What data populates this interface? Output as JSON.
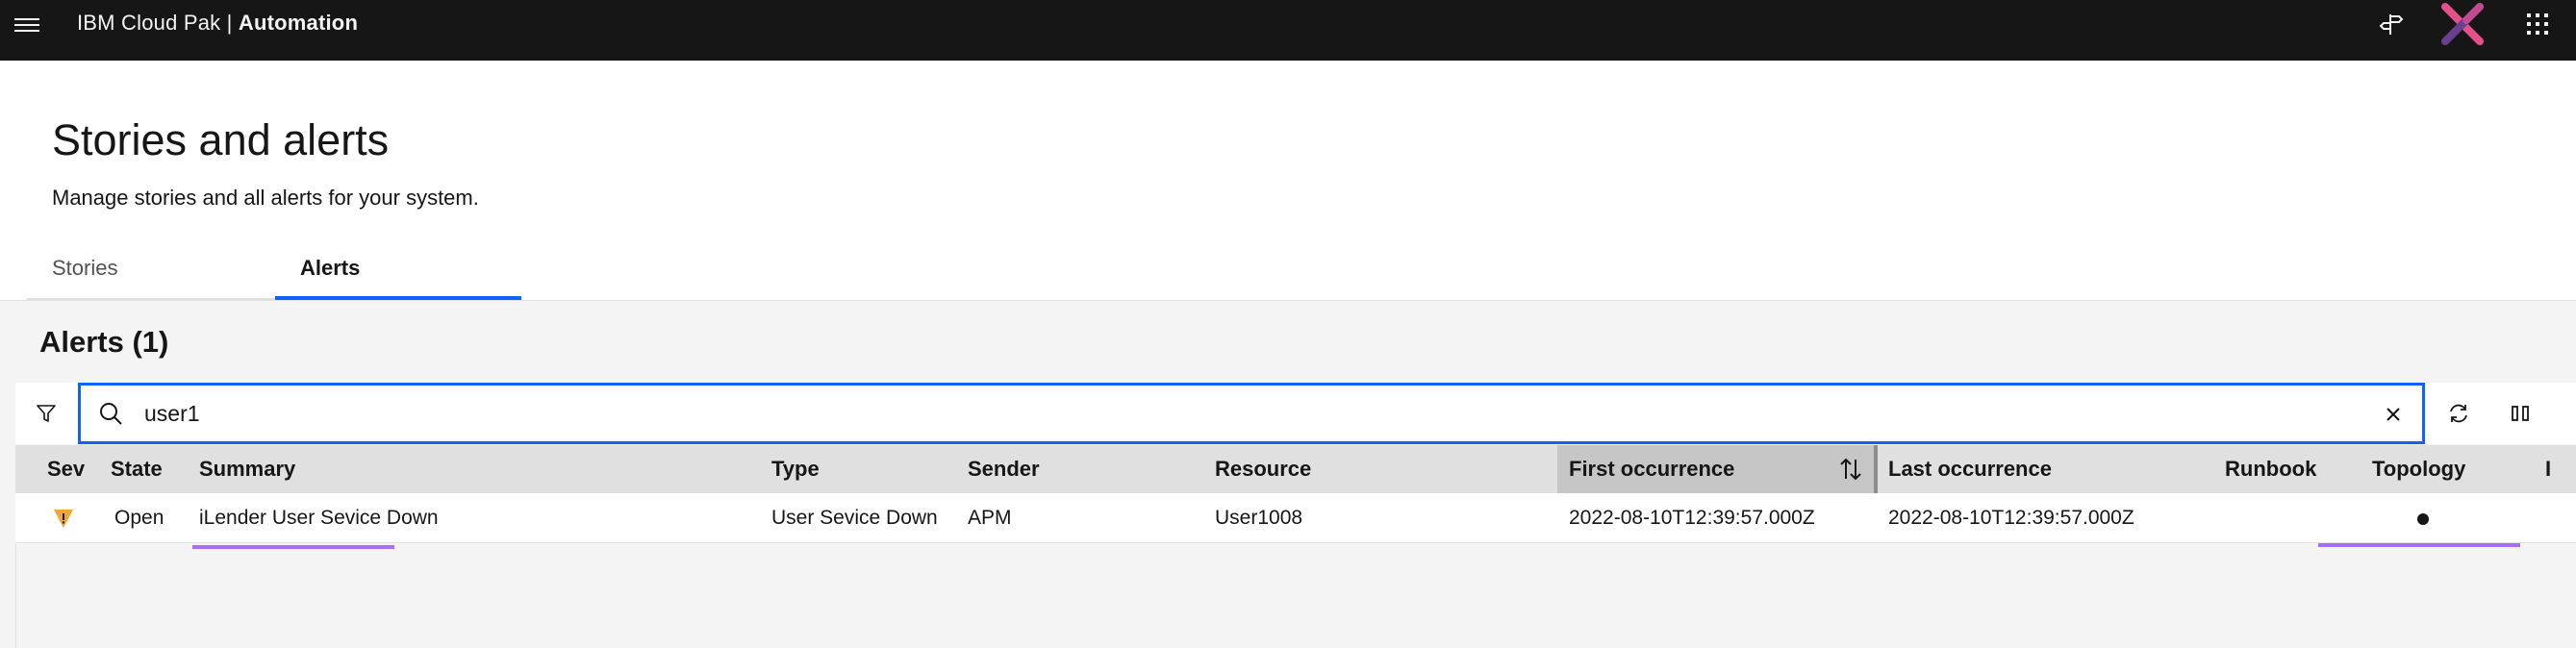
{
  "header": {
    "brand_prefix": "IBM Cloud Pak |",
    "brand_product": "Automation",
    "icons": [
      "menu-icon",
      "signpost-icon",
      "avatar-icon",
      "app-switcher-icon"
    ]
  },
  "page": {
    "title": "Stories and alerts",
    "description": "Manage stories and all alerts for your system.",
    "tabs": [
      {
        "label": "Stories",
        "selected": false
      },
      {
        "label": "Alerts",
        "selected": true
      }
    ]
  },
  "alerts": {
    "title": "Alerts (1)",
    "search_value": "user1",
    "toolbar_icons": [
      "filter-icon",
      "search-icon",
      "close-icon",
      "refresh-icon",
      "columns-icon"
    ]
  },
  "table": {
    "columns": {
      "sev": "Sev",
      "state": "State",
      "summary": "Summary",
      "type": "Type",
      "sender": "Sender",
      "resource": "Resource",
      "first": "First occurrence",
      "last": "Last occurrence",
      "runbook": "Runbook",
      "topology": "Topology",
      "extra": "I"
    },
    "sorted_column": "First occurrence",
    "rows": [
      {
        "severity": "warning",
        "state": "Open",
        "summary": "iLender User Sevice Down",
        "type": "User Sevice Down",
        "sender": "APM",
        "resource": "User1008",
        "first": "2022-08-10T12:39:57.000Z",
        "last": "2022-08-10T12:39:57.000Z",
        "runbook": "",
        "topology": "available"
      }
    ]
  },
  "colors": {
    "header_bg": "#161616",
    "accent": "#0f62fe",
    "warning": "#f1a534",
    "highlight": "#a56eff",
    "avatar_x_left": "#e4508a",
    "avatar_x_right": "#6b3f8f"
  }
}
